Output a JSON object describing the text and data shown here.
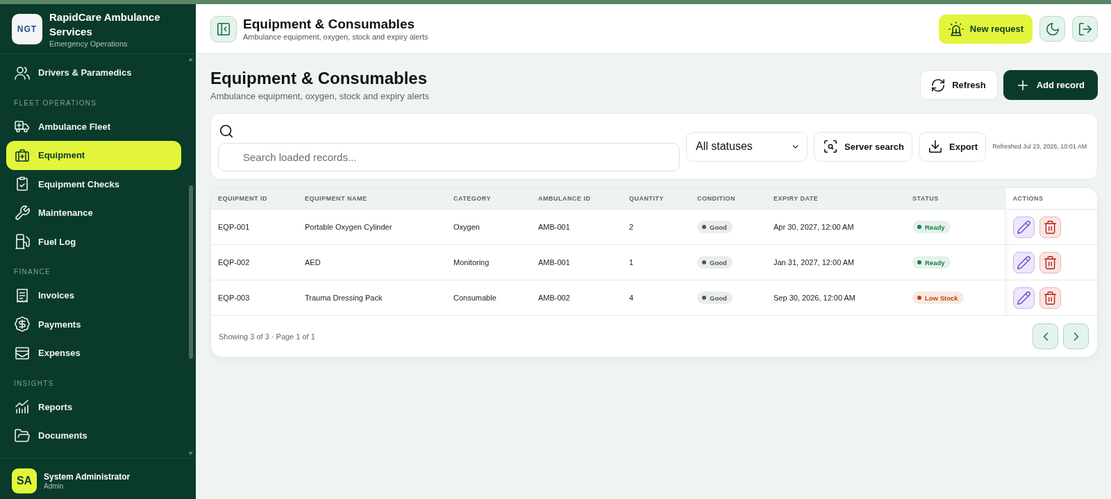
{
  "top_bar": {
    "title": "Equipment & Consumables",
    "subtitle": "Ambulance equipment, oxygen, stock and expiry alerts",
    "new_request": {
      "label": "New request"
    }
  },
  "sidebar": {
    "brand": {
      "logo_text": "NGT",
      "name": "RapidCare Ambulance Services",
      "subtitle": "Emergency Operations"
    },
    "nav": [
      {
        "items": [
          {
            "label": "Drivers & Paramedics",
            "selected": false
          }
        ]
      },
      {
        "heading": "FLEET OPERATIONS",
        "items": [
          {
            "label": "Ambulance Fleet",
            "selected": false
          },
          {
            "label": "Equipment",
            "selected": true
          },
          {
            "label": "Equipment Checks",
            "selected": false
          },
          {
            "label": "Maintenance",
            "selected": false
          },
          {
            "label": "Fuel Log",
            "selected": false
          }
        ]
      },
      {
        "heading": "FINANCE",
        "items": [
          {
            "label": "Invoices",
            "selected": false
          },
          {
            "label": "Payments",
            "selected": false
          },
          {
            "label": "Expenses",
            "selected": false
          }
        ]
      },
      {
        "heading": "INSIGHTS",
        "items": [
          {
            "label": "Reports",
            "selected": false
          },
          {
            "label": "Documents",
            "selected": false
          }
        ]
      }
    ],
    "user": {
      "initials": "SA",
      "name": "System Administrator",
      "role": "Admin"
    }
  },
  "page": {
    "title": "Equipment & Consumables",
    "subtitle": "Ambulance equipment, oxygen, stock and expiry alerts",
    "buttons": [
      {
        "kind": "secondary",
        "label": "Refresh"
      },
      {
        "kind": "primary",
        "label": "Add record"
      }
    ]
  },
  "filters": {
    "search": {
      "placeholder": "Search loaded records..."
    },
    "status_select": {
      "value": "All statuses"
    },
    "buttons": [
      {
        "label": "Server search"
      },
      {
        "label": "Export"
      }
    ],
    "refreshed": "Refreshed Jul 23, 2026, 10:01 AM"
  },
  "table": {
    "columns": [
      "EQUIPMENT ID",
      "EQUIPMENT NAME",
      "CATEGORY",
      "AMBULANCE ID",
      "QUANTITY",
      "CONDITION",
      "EXPIRY DATE",
      "STATUS",
      "ACTIONS"
    ],
    "rows": [
      {
        "equipment_id": "EQP-001",
        "equipment_name": "Portable Oxygen Cylinder",
        "category": "Oxygen",
        "ambulance_id": "AMB-001",
        "quantity": "2",
        "condition": {
          "label": "Good",
          "color": "#4b5a55"
        },
        "expiry_date": "Apr 30, 2027, 12:00 AM",
        "status": {
          "label": "Ready",
          "color": "#17804c"
        }
      },
      {
        "equipment_id": "EQP-002",
        "equipment_name": "AED",
        "category": "Monitoring",
        "ambulance_id": "AMB-001",
        "quantity": "1",
        "condition": {
          "label": "Good",
          "color": "#4b5a55"
        },
        "expiry_date": "Jan 31, 2027, 12:00 AM",
        "status": {
          "label": "Ready",
          "color": "#17804c"
        }
      },
      {
        "equipment_id": "EQP-003",
        "equipment_name": "Trauma Dressing Pack",
        "category": "Consumable",
        "ambulance_id": "AMB-002",
        "quantity": "4",
        "condition": {
          "label": "Good",
          "color": "#4b5a55"
        },
        "expiry_date": "Sep 30, 2026, 12:00 AM",
        "status": {
          "label": "Low Stock",
          "color": "#c2410c"
        }
      }
    ],
    "footer": "Showing 3 of 3 · Page 1 of 1"
  }
}
